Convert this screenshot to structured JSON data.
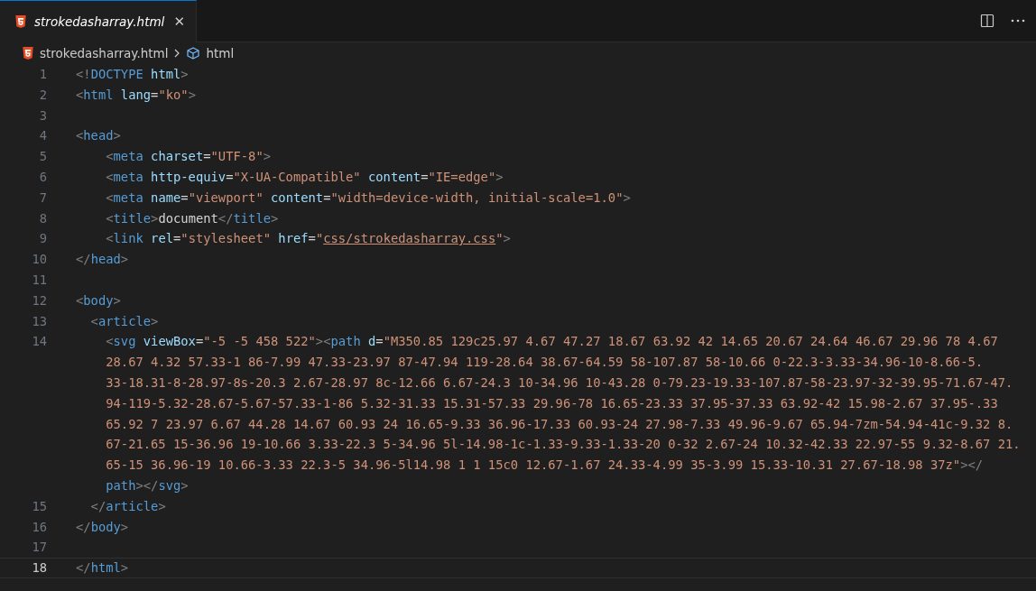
{
  "tab": {
    "title": "strokedasharray.html",
    "preview": true,
    "selected": true,
    "close": "✕"
  },
  "breadcrumb": [
    {
      "label": "strokedasharray.html",
      "kind": "file"
    },
    {
      "label": "html",
      "kind": "symbol"
    }
  ],
  "lines": [
    {
      "number": "1",
      "current": false,
      "rows": [
        {
          "tokens": [
            {
              "text": "<!",
              "kind": "p"
            },
            {
              "text": "DOCTYPE",
              "kind": "tag"
            },
            {
              "text": " html",
              "kind": "attr"
            },
            {
              "text": ">",
              "kind": "p"
            }
          ]
        }
      ]
    },
    {
      "number": "2",
      "current": false,
      "rows": [
        {
          "tokens": [
            {
              "text": "<",
              "kind": "p"
            },
            {
              "text": "html",
              "kind": "tag"
            },
            {
              "text": " lang",
              "kind": "attr"
            },
            {
              "text": "=",
              "kind": "x"
            },
            {
              "text": "\"ko\"",
              "kind": "str"
            },
            {
              "text": ">",
              "kind": "p"
            }
          ]
        }
      ]
    },
    {
      "number": "3",
      "current": false
    },
    {
      "number": "4",
      "current": false,
      "rows": [
        {
          "tokens": [
            {
              "text": "<",
              "kind": "p"
            },
            {
              "text": "head",
              "kind": "tag"
            },
            {
              "text": ">",
              "kind": "p"
            }
          ]
        }
      ]
    },
    {
      "number": "5",
      "current": false,
      "rows": [
        {
          "tokens": [
            {
              "text": "    <",
              "kind": "p"
            },
            {
              "text": "meta",
              "kind": "tag"
            },
            {
              "text": " charset",
              "kind": "attr"
            },
            {
              "text": "=",
              "kind": "x"
            },
            {
              "text": "\"UTF-8\"",
              "kind": "str"
            },
            {
              "text": ">",
              "kind": "p"
            }
          ]
        }
      ]
    },
    {
      "number": "6",
      "current": false,
      "rows": [
        {
          "tokens": [
            {
              "text": "    <",
              "kind": "p"
            },
            {
              "text": "meta",
              "kind": "tag"
            },
            {
              "text": " http-equiv",
              "kind": "attr"
            },
            {
              "text": "=",
              "kind": "x"
            },
            {
              "text": "\"X-UA-Compatible\"",
              "kind": "str"
            },
            {
              "text": " content",
              "kind": "attr"
            },
            {
              "text": "=",
              "kind": "x"
            },
            {
              "text": "\"IE=edge\"",
              "kind": "str"
            },
            {
              "text": ">",
              "kind": "p"
            }
          ]
        }
      ]
    },
    {
      "number": "7",
      "current": false,
      "rows": [
        {
          "tokens": [
            {
              "text": "    <",
              "kind": "p"
            },
            {
              "text": "meta",
              "kind": "tag"
            },
            {
              "text": " name",
              "kind": "attr"
            },
            {
              "text": "=",
              "kind": "x"
            },
            {
              "text": "\"viewport\"",
              "kind": "str"
            },
            {
              "text": " content",
              "kind": "attr"
            },
            {
              "text": "=",
              "kind": "x"
            },
            {
              "text": "\"width=device-width, initial-scale=1.0\"",
              "kind": "str"
            },
            {
              "text": ">",
              "kind": "p"
            }
          ]
        }
      ]
    },
    {
      "number": "8",
      "current": false,
      "rows": [
        {
          "tokens": [
            {
              "text": "    <",
              "kind": "p"
            },
            {
              "text": "title",
              "kind": "tag"
            },
            {
              "text": ">",
              "kind": "p"
            },
            {
              "text": "document",
              "kind": "x"
            },
            {
              "text": "</",
              "kind": "p"
            },
            {
              "text": "title",
              "kind": "tag"
            },
            {
              "text": ">",
              "kind": "p"
            }
          ]
        }
      ]
    },
    {
      "number": "9",
      "current": false,
      "rows": [
        {
          "tokens": [
            {
              "text": "    <",
              "kind": "p"
            },
            {
              "text": "link",
              "kind": "tag"
            },
            {
              "text": " rel",
              "kind": "attr"
            },
            {
              "text": "=",
              "kind": "x"
            },
            {
              "text": "\"stylesheet\"",
              "kind": "str"
            },
            {
              "text": " href",
              "kind": "attr"
            },
            {
              "text": "=",
              "kind": "x"
            },
            {
              "text": "\"",
              "kind": "str"
            },
            {
              "text": "css/strokedasharray.css",
              "kind": "link"
            },
            {
              "text": "\"",
              "kind": "str"
            },
            {
              "text": ">",
              "kind": "p"
            }
          ]
        }
      ]
    },
    {
      "number": "10",
      "current": false,
      "rows": [
        {
          "tokens": [
            {
              "text": "</",
              "kind": "p"
            },
            {
              "text": "head",
              "kind": "tag"
            },
            {
              "text": ">",
              "kind": "p"
            }
          ]
        }
      ]
    },
    {
      "number": "11",
      "current": false
    },
    {
      "number": "12",
      "current": false,
      "rows": [
        {
          "tokens": [
            {
              "text": "<",
              "kind": "p"
            },
            {
              "text": "body",
              "kind": "tag"
            },
            {
              "text": ">",
              "kind": "p"
            }
          ]
        }
      ]
    },
    {
      "number": "13",
      "current": false,
      "rows": [
        {
          "tokens": [
            {
              "text": "  <",
              "kind": "p"
            },
            {
              "text": "article",
              "kind": "tag"
            },
            {
              "text": ">",
              "kind": "p"
            }
          ]
        }
      ]
    },
    {
      "number": "14",
      "current": false,
      "rows": [
        {
          "tokens": [
            {
              "text": "    <",
              "kind": "p"
            },
            {
              "text": "svg",
              "kind": "tag"
            },
            {
              "text": " viewBox",
              "kind": "attr"
            },
            {
              "text": "=",
              "kind": "x"
            },
            {
              "text": "\"-5 -5 458 522\"",
              "kind": "str"
            },
            {
              "text": "><",
              "kind": "p"
            },
            {
              "text": "path",
              "kind": "tag"
            },
            {
              "text": " d",
              "kind": "attr"
            },
            {
              "text": "=",
              "kind": "x"
            },
            {
              "text": "\"M350.85 129c25.97 4.67 47.27 18.67 63.92 42 14.65 20.67 24.64 46.67 29.96 78 4.67",
              "kind": "str"
            }
          ]
        },
        {
          "tokens": [
            {
              "text": "    28.67 4.32 57.33-1 86-7.99 47.33-23.97 87-47.94 119-28.64 38.67-64.59 58-107.87 58-10.66 0-22.3-3.33-34.96-10-8.66-5.",
              "kind": "str"
            }
          ]
        },
        {
          "tokens": [
            {
              "text": "    33-18.31-8-28.97-8s-20.3 2.67-28.97 8c-12.66 6.67-24.3 10-34.96 10-43.28 0-79.23-19.33-107.87-58-23.97-32-39.95-71.67-47.",
              "kind": "str"
            }
          ]
        },
        {
          "tokens": [
            {
              "text": "    94-119-5.32-28.67-5.67-57.33-1-86 5.32-31.33 15.31-57.33 29.96-78 16.65-23.33 37.95-37.33 63.92-42 15.98-2.67 37.95-.33",
              "kind": "str"
            }
          ]
        },
        {
          "tokens": [
            {
              "text": "    65.92 7 23.97 6.67 44.28 14.67 60.93 24 16.65-9.33 36.96-17.33 60.93-24 27.98-7.33 49.96-9.67 65.94-7zm-54.94-41c-9.32 8.",
              "kind": "str"
            }
          ]
        },
        {
          "tokens": [
            {
              "text": "    67-21.65 15-36.96 19-10.66 3.33-22.3 5-34.96 5l-14.98-1c-1.33-9.33-1.33-20 0-32 2.67-24 10.32-42.33 22.97-55 9.32-8.67 21.",
              "kind": "str"
            }
          ]
        },
        {
          "tokens": [
            {
              "text": "    65-15 36.96-19 10.66-3.33 22.3-5 34.96-5l14.98 1 1 15c0 12.67-1.67 24.33-4.99 35-3.99 15.33-10.31 27.67-18.98 37z\"",
              "kind": "str"
            },
            {
              "text": "></",
              "kind": "p"
            }
          ]
        },
        {
          "tokens": [
            {
              "text": "    path",
              "kind": "tag"
            },
            {
              "text": "></",
              "kind": "p"
            },
            {
              "text": "svg",
              "kind": "tag"
            },
            {
              "text": ">",
              "kind": "p"
            }
          ]
        }
      ]
    },
    {
      "number": "15",
      "current": false,
      "rows": [
        {
          "tokens": [
            {
              "text": "  </",
              "kind": "p"
            },
            {
              "text": "article",
              "kind": "tag"
            },
            {
              "text": ">",
              "kind": "p"
            }
          ]
        }
      ]
    },
    {
      "number": "16",
      "current": false,
      "rows": [
        {
          "tokens": [
            {
              "text": "</",
              "kind": "p"
            },
            {
              "text": "body",
              "kind": "tag"
            },
            {
              "text": ">",
              "kind": "p"
            }
          ]
        }
      ]
    },
    {
      "number": "17",
      "current": false
    },
    {
      "number": "18",
      "current": true,
      "rows": [
        {
          "tokens": [
            {
              "text": "</",
              "kind": "p"
            },
            {
              "text": "html",
              "kind": "tag"
            },
            {
              "text": ">",
              "kind": "p"
            }
          ]
        }
      ]
    }
  ]
}
